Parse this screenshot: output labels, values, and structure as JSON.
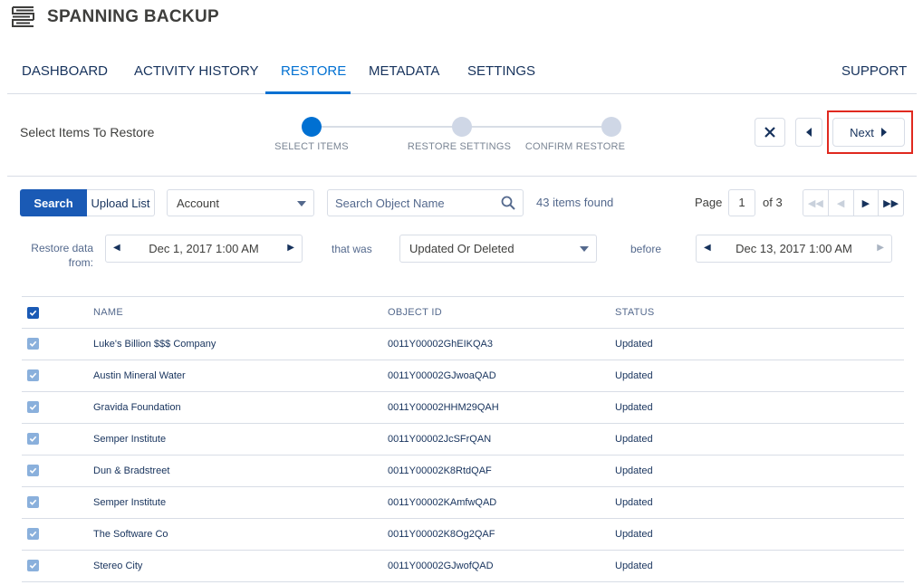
{
  "app": {
    "title": "SPANNING BACKUP"
  },
  "nav": {
    "tabs": [
      "DASHBOARD",
      "ACTIVITY HISTORY",
      "RESTORE",
      "METADATA",
      "SETTINGS"
    ],
    "active": "RESTORE",
    "support": "SUPPORT"
  },
  "wizard": {
    "heading": "Select Items To Restore",
    "steps": [
      "SELECT ITEMS",
      "RESTORE SETTINGS",
      "CONFIRM RESTORE"
    ],
    "current_step": 1,
    "next_label": "Next"
  },
  "toolbar": {
    "search_label": "Search",
    "upload_label": "Upload List",
    "object_type": "Account",
    "search_placeholder": "Search Object Name",
    "items_found": "43 items found",
    "page_label": "Page",
    "page_value": "1",
    "page_total": "of 3"
  },
  "filters": {
    "from_label": "Restore data from:",
    "from_date": "Dec 1, 2017 1:00 AM",
    "that_was": "that was",
    "change_type": "Updated Or Deleted",
    "before_label": "before",
    "before_date": "Dec 13, 2017 1:00 AM"
  },
  "table": {
    "headers": {
      "name": "NAME",
      "object_id": "OBJECT ID",
      "status": "STATUS"
    },
    "rows": [
      {
        "name": "Luke's Billion $$$ Company",
        "object_id": "0011Y00002GhEIKQA3",
        "status": "Updated"
      },
      {
        "name": "Austin Mineral Water",
        "object_id": "0011Y00002GJwoaQAD",
        "status": "Updated"
      },
      {
        "name": "Gravida Foundation",
        "object_id": "0011Y00002HHM29QAH",
        "status": "Updated"
      },
      {
        "name": "Semper Institute",
        "object_id": "0011Y00002JcSFrQAN",
        "status": "Updated"
      },
      {
        "name": "Dun & Bradstreet",
        "object_id": "0011Y00002K8RtdQAF",
        "status": "Updated"
      },
      {
        "name": "Semper Institute",
        "object_id": "0011Y00002KAmfwQAD",
        "status": "Updated"
      },
      {
        "name": "The Software Co",
        "object_id": "0011Y00002K8Og2QAF",
        "status": "Updated"
      },
      {
        "name": "Stereo City",
        "object_id": "0011Y00002GJwofQAD",
        "status": "Updated"
      }
    ]
  },
  "colors": {
    "accent": "#0070d2",
    "primary_button": "#1a5ab5",
    "highlight": "#e0291f",
    "text": "#16325c"
  }
}
